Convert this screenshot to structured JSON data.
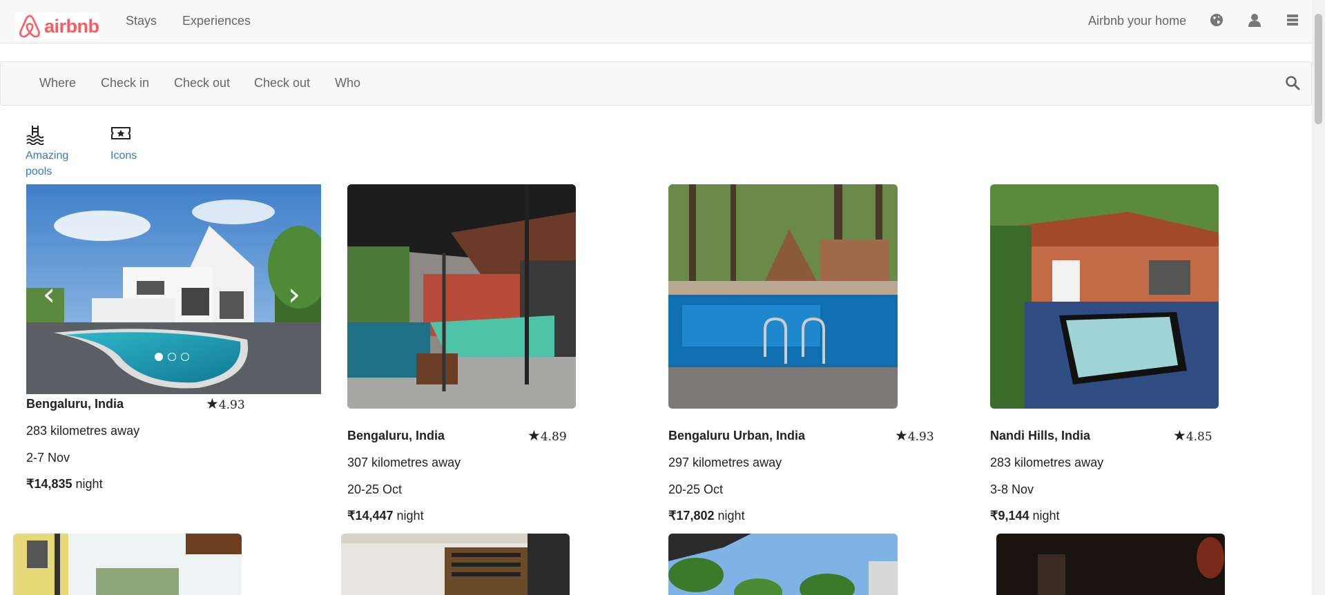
{
  "brand": {
    "name": "airbnb",
    "color": "#ff5a5f"
  },
  "nav": {
    "links": [
      "Stays",
      "Experiences"
    ],
    "host_link": "Airbnb your home",
    "icons": [
      "globe-icon",
      "user-icon",
      "menu-icon"
    ]
  },
  "search": {
    "fields": [
      "Where",
      "Check in",
      "Check out",
      "Check out",
      "Who"
    ],
    "icon": "search-icon"
  },
  "categories": [
    {
      "label": "Amazing pools",
      "icon": "pool-icon"
    },
    {
      "label": "Icons",
      "icon": "ticket-star-icon"
    }
  ],
  "listings": [
    {
      "location": "Bengaluru, India",
      "rating": "4.93",
      "distance": "283 kilometres away",
      "dates": "2-7 Nov",
      "price": "₹14,835",
      "price_unit": "night"
    },
    {
      "location": "Bengaluru, India",
      "rating": "4.89",
      "distance": "307 kilometres away",
      "dates": "20-25 Oct",
      "price": "₹14,447",
      "price_unit": "night"
    },
    {
      "location": "Bengaluru Urban, India",
      "rating": "4.93",
      "distance": "297 kilometres away",
      "dates": "20-25 Oct",
      "price": "₹17,802",
      "price_unit": "night"
    },
    {
      "location": "Nandi Hills, India",
      "rating": "4.85",
      "distance": "283 kilometres away",
      "dates": "3-8 Nov",
      "price": "₹9,144",
      "price_unit": "night"
    }
  ],
  "carousel": {
    "total_images": 3,
    "active_index": 0
  }
}
